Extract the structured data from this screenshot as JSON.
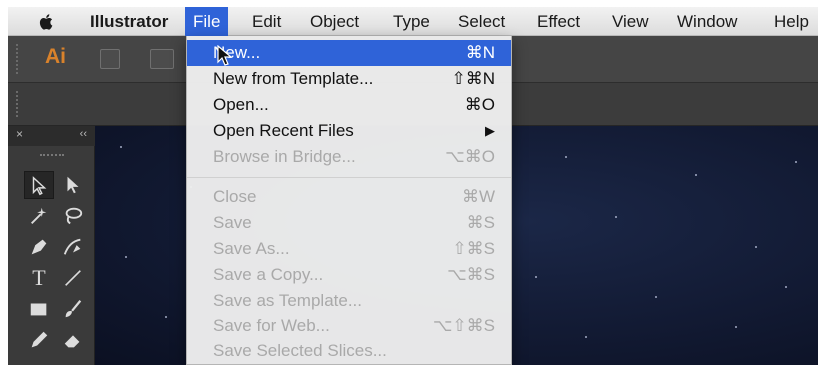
{
  "menubar": {
    "app_name": "Illustrator",
    "items": [
      {
        "label": "File"
      },
      {
        "label": "Edit"
      },
      {
        "label": "Object"
      },
      {
        "label": "Type"
      },
      {
        "label": "Select"
      },
      {
        "label": "Effect"
      },
      {
        "label": "View"
      },
      {
        "label": "Window"
      },
      {
        "label": "Help"
      }
    ],
    "active_item": "File",
    "highlight_color": "#2f63d8"
  },
  "appbar": {
    "logo_text": "Ai",
    "logo_color": "#d9822b"
  },
  "tools_panel": {
    "close_glyph": "×",
    "collapse_glyph": "‹‹",
    "tools": [
      {
        "icon": "selection-tool-icon"
      },
      {
        "icon": "direct-selection-tool-icon"
      },
      {
        "icon": "magic-wand-tool-icon"
      },
      {
        "icon": "lasso-tool-icon"
      },
      {
        "icon": "pen-tool-icon"
      },
      {
        "icon": "curvature-tool-icon"
      },
      {
        "icon": "type-tool-icon",
        "glyph": "T"
      },
      {
        "icon": "line-segment-tool-icon"
      },
      {
        "icon": "rectangle-tool-icon"
      },
      {
        "icon": "paintbrush-tool-icon"
      },
      {
        "icon": "pencil-tool-icon"
      },
      {
        "icon": "eraser-tool-icon"
      }
    ]
  },
  "file_menu": {
    "items": [
      {
        "label": "New...",
        "shortcut": "⌘N",
        "enabled": true,
        "highlighted": true
      },
      {
        "label": "New from Template...",
        "shortcut": "⇧⌘N",
        "enabled": true
      },
      {
        "label": "Open...",
        "shortcut": "⌘O",
        "enabled": true
      },
      {
        "label": "Open Recent Files",
        "shortcut": "▶",
        "enabled": true
      },
      {
        "label": "Browse in Bridge...",
        "shortcut": "⌥⌘O",
        "enabled": false
      },
      {
        "label": "Close",
        "shortcut": "⌘W",
        "enabled": false
      },
      {
        "label": "Save",
        "shortcut": "⌘S",
        "enabled": false
      },
      {
        "label": "Save As...",
        "shortcut": "⇧⌘S",
        "enabled": false
      },
      {
        "label": "Save a Copy...",
        "shortcut": "⌥⌘S",
        "enabled": false
      },
      {
        "label": "Save as Template...",
        "shortcut": "",
        "enabled": false
      },
      {
        "label": "Save for Web...",
        "shortcut": "⌥⇧⌘S",
        "enabled": false
      },
      {
        "label": "Save Selected Slices...",
        "shortcut": "",
        "enabled": false
      }
    ]
  }
}
